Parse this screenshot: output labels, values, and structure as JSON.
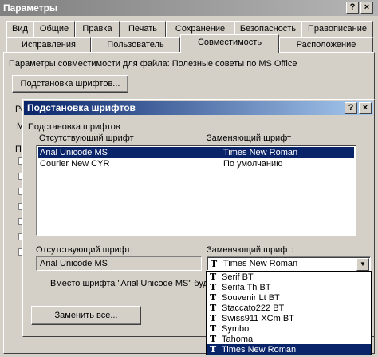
{
  "outer_window": {
    "title": "Параметры",
    "help_icon": "?",
    "close_icon": "×"
  },
  "tabs_row1": [
    "Вид",
    "Общие",
    "Правка",
    "Печать",
    "Сохранение",
    "Безопасность",
    "Правописание"
  ],
  "tabs_row2": [
    "Исправления",
    "Пользователь",
    "Совместимость",
    "Расположение"
  ],
  "compat": {
    "options_label": "Параметры совместимости для файла: Полезные советы по MS Office",
    "font_subst_button": "Подстановка шрифтов..."
  },
  "edge_letters": [
    "Ре",
    "M",
    "Па"
  ],
  "dialog": {
    "title": "Подстановка шрифтов",
    "help_icon": "?",
    "close_icon": "×",
    "group_label": "Подстановка шрифтов",
    "col_missing": "Отсутствующий шрифт",
    "col_replacing": "Заменяющий шрифт",
    "rows": [
      {
        "missing": "Arial Unicode MS",
        "replacing": "Times New Roman",
        "selected": true
      },
      {
        "missing": "Courier New CYR",
        "replacing": "По умолчанию",
        "selected": false
      }
    ],
    "missing_label": "Отсутствующий шрифт:",
    "replacing_label": "Заменяющий шрифт:",
    "missing_value": "Arial Unicode MS",
    "replacing_value": "Times New Roman",
    "note": "Вместо шрифта \"Arial Unicode MS\" будет",
    "replace_all_button": "Заменить все..."
  },
  "dropdown_items": [
    {
      "label": "Serif BT",
      "selected": false
    },
    {
      "label": "Serifa Th BT",
      "selected": false
    },
    {
      "label": "Souvenir Lt BT",
      "selected": false
    },
    {
      "label": "Staccato222 BT",
      "selected": false
    },
    {
      "label": "Swiss911 XCm BT",
      "selected": false
    },
    {
      "label": "Symbol",
      "selected": false
    },
    {
      "label": "Tahoma",
      "selected": false
    },
    {
      "label": "Times New Roman",
      "selected": true
    }
  ],
  "truetype_icon_glyph": "T"
}
